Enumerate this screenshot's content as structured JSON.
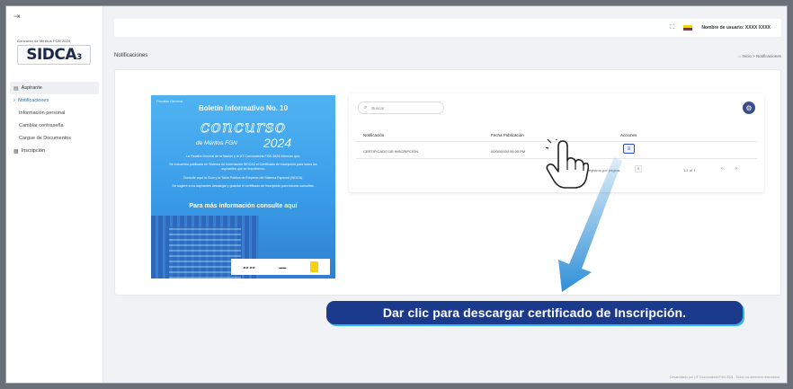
{
  "app": {
    "brand_caption": "Concurso de Méritos FGN 2024",
    "brand_name": "SIDCA",
    "brand_version": "3"
  },
  "sidebar": {
    "toggle_icon": "menu-icon",
    "items": [
      {
        "label": "Aspirante",
        "icon": "user-icon"
      },
      {
        "label": "Notificaciones",
        "icon": "chevron-icon"
      },
      {
        "label": "Información personal"
      },
      {
        "label": "Cambiar contraseña"
      },
      {
        "label": "Cargue de Documentos"
      },
      {
        "label": "Inscripción",
        "icon": "grid-icon"
      }
    ]
  },
  "topbar": {
    "fullscreen_icon": "fullscreen-icon",
    "user_label": "Nombre de usuario: XXXX XXXX"
  },
  "page": {
    "title": "Notificaciones",
    "breadcrumb": "Inicio > Notificaciones"
  },
  "bulletin": {
    "logo_text": "Fiscalía General",
    "heading": "Boletín Informativo No. 10",
    "concurso": "concurso",
    "subtitle": "de Méritos FGN",
    "year": "2024",
    "paragraph_1": "La Fiscalía General de la Nación y la UT Convocatoria FGN 2024 informan que:",
    "paragraph_2": "Se encuentra publicado en Sistema de Información SIDCA3 el Certificado de Inscripción para todos los aspirantes que se inscribieron.",
    "paragraph_3": "Consulte aquí la Guía y la Tabla Pública de Empleos del Sistema Especial (SIDCA).",
    "paragraph_4": "Se sugiere a los aspirantes descargar y guardar el certificado de inscripción para futuras consultas.",
    "more_prefix": "Para más información consulte",
    "more_link": "aquí"
  },
  "notifications": {
    "search_placeholder": "Buscar",
    "columns": [
      "Notificación",
      "Fecha Publicación",
      "Acciones"
    ],
    "rows": [
      {
        "notificacion": "CERTIFICADO DE INSCRIPCIÓN",
        "fecha": "00/00/0000 00:00 PM"
      }
    ],
    "per_page_label": "Registros por página:",
    "per_page_value": "5",
    "range_label": "1-1 of 1",
    "prev_icon": "‹",
    "next_icon": "›"
  },
  "callout": {
    "text": "Dar clic para descargar certificado de Inscripción."
  },
  "footer": {
    "text": "Desarrollado por UT Convocatoria FGN 2024 - Todos los derechos reservados"
  },
  "colors": {
    "callout_bg": "#1c3a8c",
    "callout_shadow": "#35b4e8",
    "arrow": "#2f8fd8",
    "action_border": "#2b4bb8"
  }
}
